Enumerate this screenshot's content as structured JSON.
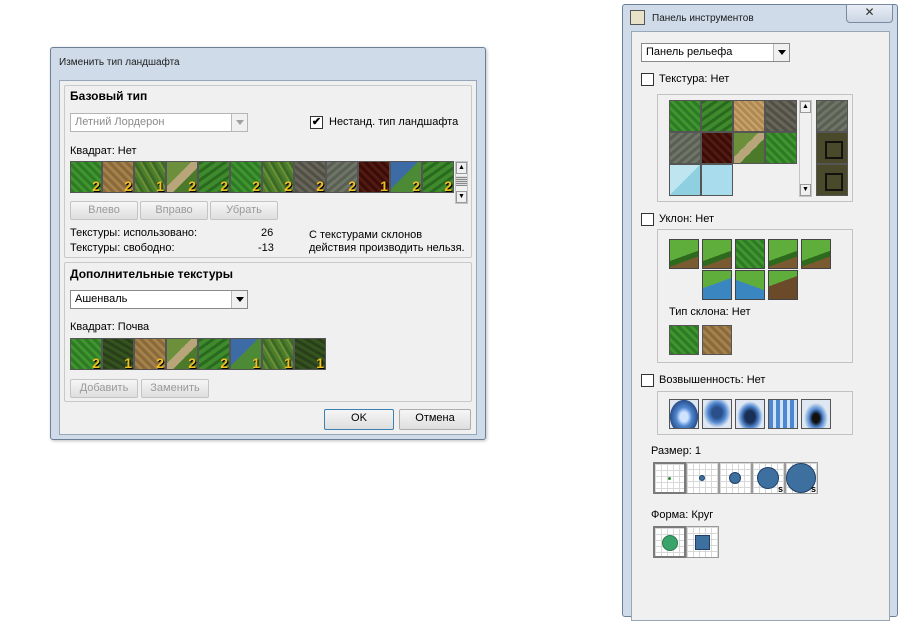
{
  "dialog": {
    "title": "Изменить тип ландшафта",
    "base": {
      "heading": "Базовый тип",
      "tileset": "Летний Лордерон",
      "custom_label": "Нестанд. тип ландшафта",
      "custom_checked": "✔",
      "square_label": "Квадрат: Нет",
      "tiles": [
        {
          "cls": "g1",
          "n": "2"
        },
        {
          "cls": "dirt",
          "n": "2"
        },
        {
          "cls": "g3",
          "n": "1"
        },
        {
          "cls": "mix",
          "n": "2"
        },
        {
          "cls": "g2",
          "n": "2"
        },
        {
          "cls": "g1",
          "n": "2"
        },
        {
          "cls": "g3",
          "n": "2"
        },
        {
          "cls": "rk",
          "n": "2"
        },
        {
          "cls": "rk2",
          "n": "2"
        },
        {
          "cls": "red",
          "n": "1"
        },
        {
          "cls": "blu",
          "n": "2"
        },
        {
          "cls": "g2",
          "n": "2"
        }
      ],
      "btn_left": "Влево",
      "btn_right": "Вправо",
      "btn_remove": "Убрать",
      "used_label": "Текстуры: использовано:",
      "used_value": "26",
      "free_label": "Текстуры: свободно:",
      "free_value": "-13",
      "note_line1": "С текстурами склонов",
      "note_line2": "действия производить нельзя."
    },
    "extra": {
      "heading": "Дополнительные текстуры",
      "tileset": "Ашенваль",
      "square_label": "Квадрат: Почва",
      "tiles": [
        {
          "cls": "g1",
          "n": "2"
        },
        {
          "cls": "dk",
          "n": "1"
        },
        {
          "cls": "dirt",
          "n": "2"
        },
        {
          "cls": "mix",
          "n": "2"
        },
        {
          "cls": "g2",
          "n": "2"
        },
        {
          "cls": "blu",
          "n": "1"
        },
        {
          "cls": "g3",
          "n": "1"
        },
        {
          "cls": "dk",
          "n": "1"
        }
      ],
      "btn_add": "Добавить",
      "btn_replace": "Заменить"
    },
    "ok": "OK",
    "cancel": "Отмена"
  },
  "panel": {
    "title": "Панель инструментов",
    "close": "✕",
    "mode": "Панель рельефа",
    "texture_label": "Текстура: Нет",
    "slope_label": "Уклон: Нет",
    "slope_type_label": "Тип склона: Нет",
    "height_label": "Возвышенность: Нет",
    "size_label": "Размер: 1",
    "size_sub_s": "s",
    "shape_label": "Форма: Круг",
    "textures": [
      {
        "cls": "g1"
      },
      {
        "cls": "g2"
      },
      {
        "cls": "sand"
      },
      {
        "cls": "rk"
      },
      {
        "cls": "rk2"
      },
      {
        "cls": "red"
      },
      {
        "cls": "mix"
      },
      {
        "cls": "g1"
      },
      {
        "cls": "ice"
      },
      {
        "cls": "ice2"
      }
    ],
    "side_textures": [
      {
        "cls": "rk2"
      },
      {
        "cls": "sq"
      },
      {
        "cls": "sq"
      }
    ]
  }
}
